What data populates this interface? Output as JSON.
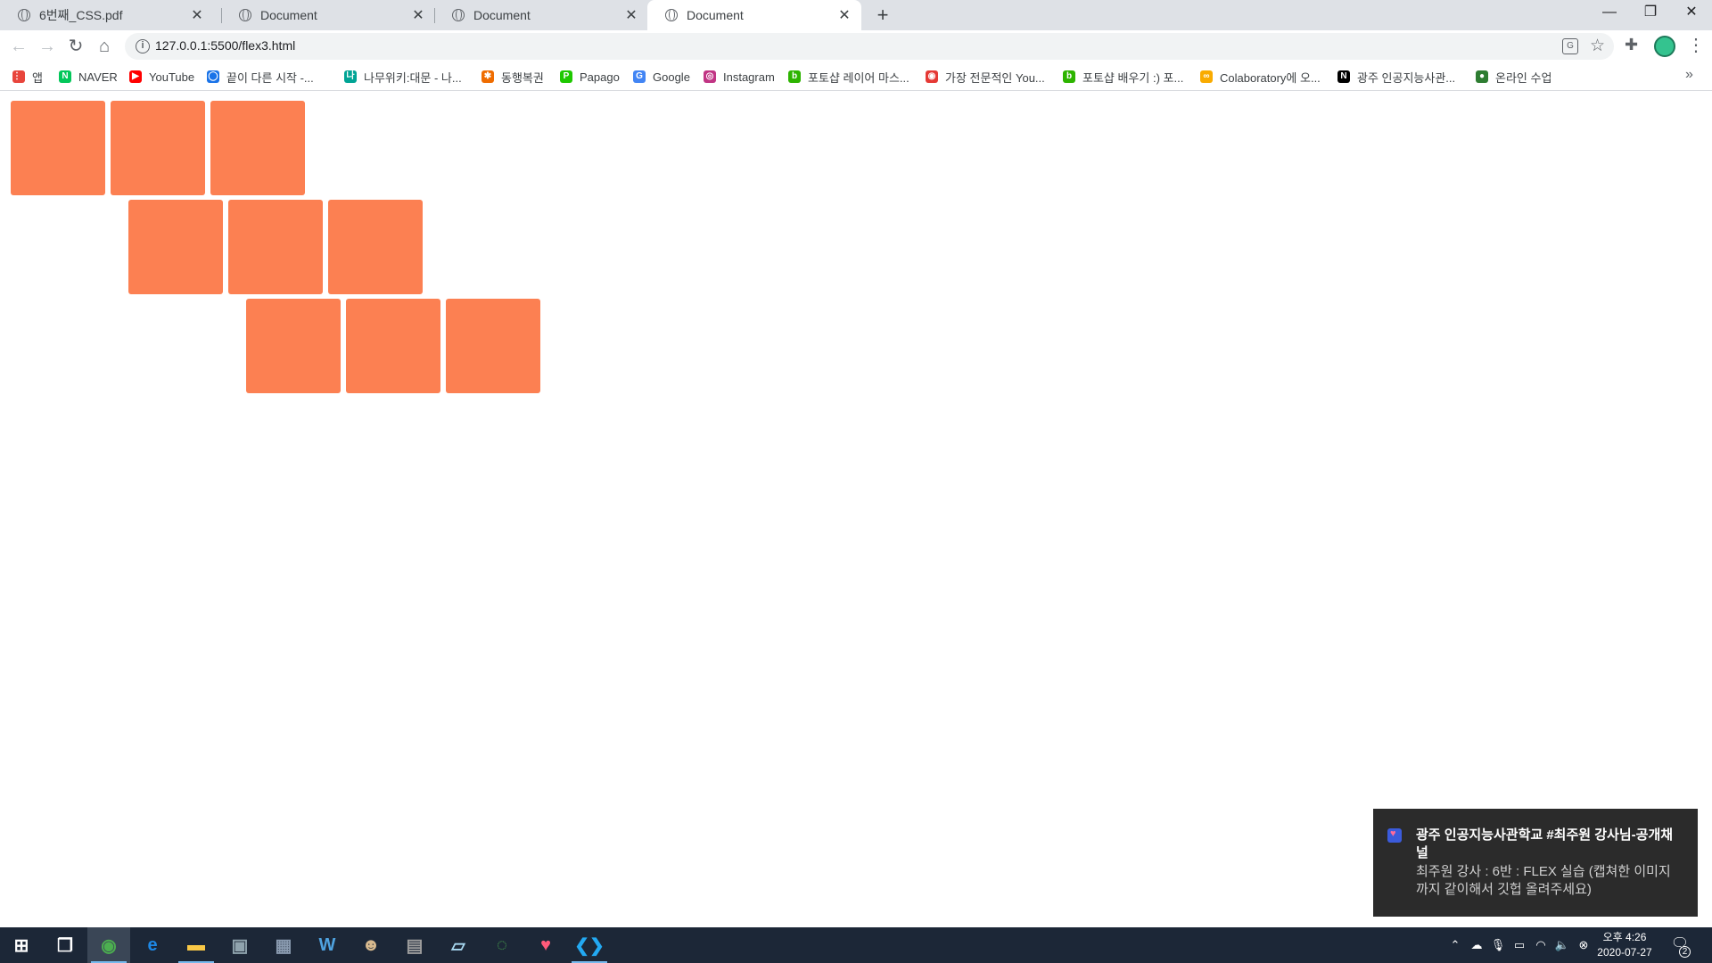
{
  "tabs": [
    {
      "title": "6번째_CSS.pdf",
      "active": false
    },
    {
      "title": "Document",
      "active": false
    },
    {
      "title": "Document",
      "active": false
    },
    {
      "title": "Document",
      "active": true
    }
  ],
  "tab_close_glyph": "✕",
  "new_tab_glyph": "+",
  "window_controls": {
    "minimize": "—",
    "restore": "❐",
    "close": "✕"
  },
  "toolbar": {
    "back_icon": "arrow-left-icon",
    "forward_icon": "arrow-right-icon",
    "reload_icon": "reload-icon",
    "home_icon": "home-icon",
    "url": "127.0.0.1:5500/flex3.html"
  },
  "bookmarks": [
    {
      "label": "앱",
      "icon": "apps-grid-icon",
      "color": "#e8453c"
    },
    {
      "label": "NAVER",
      "icon": "naver-icon",
      "color": "#03c75a"
    },
    {
      "label": "YouTube",
      "icon": "youtube-icon",
      "color": "#ff0000"
    },
    {
      "label": "끝이 다른 시작 -...",
      "icon": "chat-bubble-icon",
      "color": "#1a73e8"
    },
    {
      "label": "나무위키:대문 - 나...",
      "icon": "namuwiki-icon",
      "color": "#00a495"
    },
    {
      "label": "동행복권",
      "icon": "lottery-icon",
      "color": "#ef6c00"
    },
    {
      "label": "Papago",
      "icon": "papago-icon",
      "color": "#1ec800"
    },
    {
      "label": "Google",
      "icon": "google-icon",
      "color": "#4285f4"
    },
    {
      "label": "Instagram",
      "icon": "instagram-icon",
      "color": "#c13584"
    },
    {
      "label": "포토샵 레이어 마스...",
      "icon": "blog-icon",
      "color": "#2db400"
    },
    {
      "label": "가장 전문적인 You...",
      "icon": "circle-logo-icon",
      "color": "#e53935"
    },
    {
      "label": "포토샵 배우기 :) 포...",
      "icon": "blog-icon",
      "color": "#2db400"
    },
    {
      "label": "Colaboratory에 오...",
      "icon": "colab-icon",
      "color": "#f9ab00"
    },
    {
      "label": "광주 인공지능사관...",
      "icon": "notion-icon",
      "color": "#000000"
    },
    {
      "label": "온라인 수업",
      "icon": "speech-icon",
      "color": "#2e7d32"
    }
  ],
  "flex_demo": {
    "box_color": "#fc8052",
    "rows": [
      {
        "boxes": 3
      },
      {
        "boxes": 3
      },
      {
        "boxes": 3
      }
    ]
  },
  "toast": {
    "title": "광주 인공지능사관학교 #최주원 강사님-공개채널",
    "body": "최주원 강사 : 6반 : FLEX 실습 (캡쳐한 이미지까지 같이해서 깃헙 올려주세요)",
    "icon": "app-heart-icon"
  },
  "taskbar": {
    "apps": [
      {
        "name": "start-icon",
        "color": "#ffffff"
      },
      {
        "name": "task-view-icon",
        "color": "#ffffff"
      },
      {
        "name": "chrome-icon",
        "color": "#4caf50"
      },
      {
        "name": "edge-icon",
        "color": "#1e88e5"
      },
      {
        "name": "file-explorer-icon",
        "color": "#f9c846"
      },
      {
        "name": "remote-desktop-icon",
        "color": "#90a4ae"
      },
      {
        "name": "calculator-icon",
        "color": "#8a9bb0"
      },
      {
        "name": "word-app-icon",
        "color": "#4fa3e0"
      },
      {
        "name": "game-app-icon",
        "color": "#d7b98e"
      },
      {
        "name": "database-icon",
        "color": "#9e9e9e"
      },
      {
        "name": "notepad-app-icon",
        "color": "#a7d8f0"
      },
      {
        "name": "loading-ring-icon",
        "color": "#4caf50"
      },
      {
        "name": "heart-app-icon",
        "color": "#ff5a7a"
      },
      {
        "name": "vscode-icon",
        "color": "#23a9f2"
      }
    ],
    "tray_icons": [
      "chevron-up-icon",
      "onedrive-icon",
      "microphone-icon",
      "battery-icon",
      "wifi-icon",
      "volume-icon",
      "blocked-icon"
    ],
    "clock_time": "오후 4:26",
    "clock_date": "2020-07-27",
    "notification_count": "2"
  }
}
